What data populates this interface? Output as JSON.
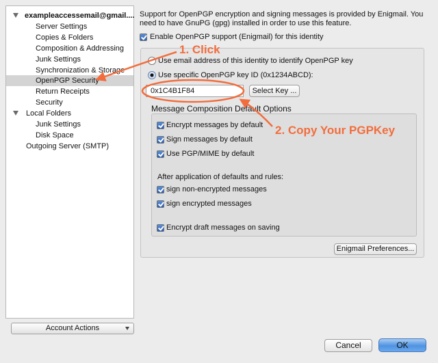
{
  "sidebar": {
    "account": "exampleaccessemail@gmail....",
    "items": [
      "Server Settings",
      "Copies & Folders",
      "Composition & Addressing",
      "Junk Settings",
      "Synchronization & Storage",
      "OpenPGP Security",
      "Return Receipts",
      "Security"
    ],
    "local_folders": "Local Folders",
    "local_items": [
      "Junk Settings",
      "Disk Space"
    ],
    "outgoing": "Outgoing Server (SMTP)",
    "account_actions": "Account Actions"
  },
  "main": {
    "support_text": "Support for OpenPGP encryption and signing messages is provided by Enigmail. You need to have GnuPG (gpg) installed in order to use this feature.",
    "enable_label": "Enable OpenPGP support (Enigmail) for this identity",
    "radio_email": "Use email address of this identity to identify OpenPGP key",
    "radio_specific": "Use specific OpenPGP key ID (0x1234ABCD):",
    "key_value": "0x1C4B1F84",
    "select_key": "Select Key ...",
    "section_title": "Message Composition Default Options",
    "encrypt_default": "Encrypt messages by default",
    "sign_default": "Sign messages by default",
    "pgpmime_default": "Use PGP/MIME by default",
    "after_rules": "After application of defaults and rules:",
    "sign_nonenc": "sign non-encrypted messages",
    "sign_enc": "sign encrypted messages",
    "encrypt_draft": "Encrypt draft messages on saving",
    "enigmail_prefs": "Enigmail Preferences..."
  },
  "footer": {
    "cancel": "Cancel",
    "ok": "OK"
  },
  "annotations": {
    "step1": "1. Click",
    "step2": "2. Copy Your PGPKey",
    "color": "#f26d3d"
  }
}
